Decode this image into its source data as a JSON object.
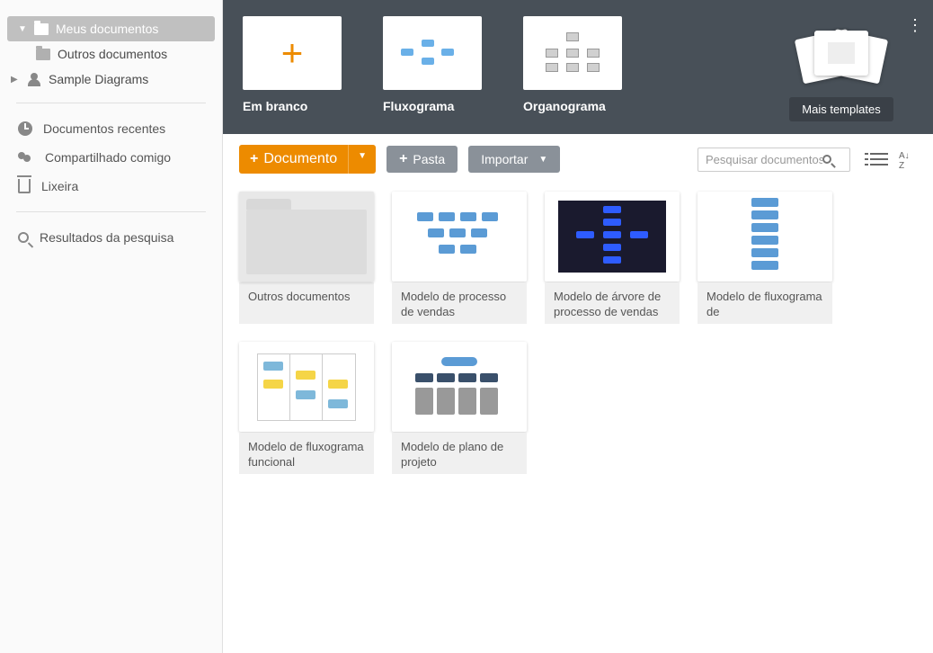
{
  "sidebar": {
    "my_docs": "Meus documentos",
    "other_docs": "Outros documentos",
    "sample": "Sample Diagrams",
    "recent": "Documentos recentes",
    "shared": "Compartilhado comigo",
    "trash": "Lixeira",
    "search_results": "Resultados da pesquisa"
  },
  "templates": {
    "blank": "Em branco",
    "flowchart": "Fluxograma",
    "orgchart": "Organograma",
    "more": "Mais templates"
  },
  "toolbar": {
    "document": "Documento",
    "folder": "Pasta",
    "import": "Importar",
    "search_placeholder": "Pesquisar documentos"
  },
  "cards": [
    {
      "title": "Outros documentos",
      "kind": "folder"
    },
    {
      "title": "Modelo de processo de vendas",
      "kind": "flowlight"
    },
    {
      "title": "Modelo de árvore de processo de vendas",
      "kind": "dark"
    },
    {
      "title": "Modelo de fluxograma de",
      "kind": "vert"
    },
    {
      "title": "Modelo de fluxograma funcional",
      "kind": "swim"
    },
    {
      "title": "Modelo de plano de projeto",
      "kind": "plan"
    }
  ]
}
